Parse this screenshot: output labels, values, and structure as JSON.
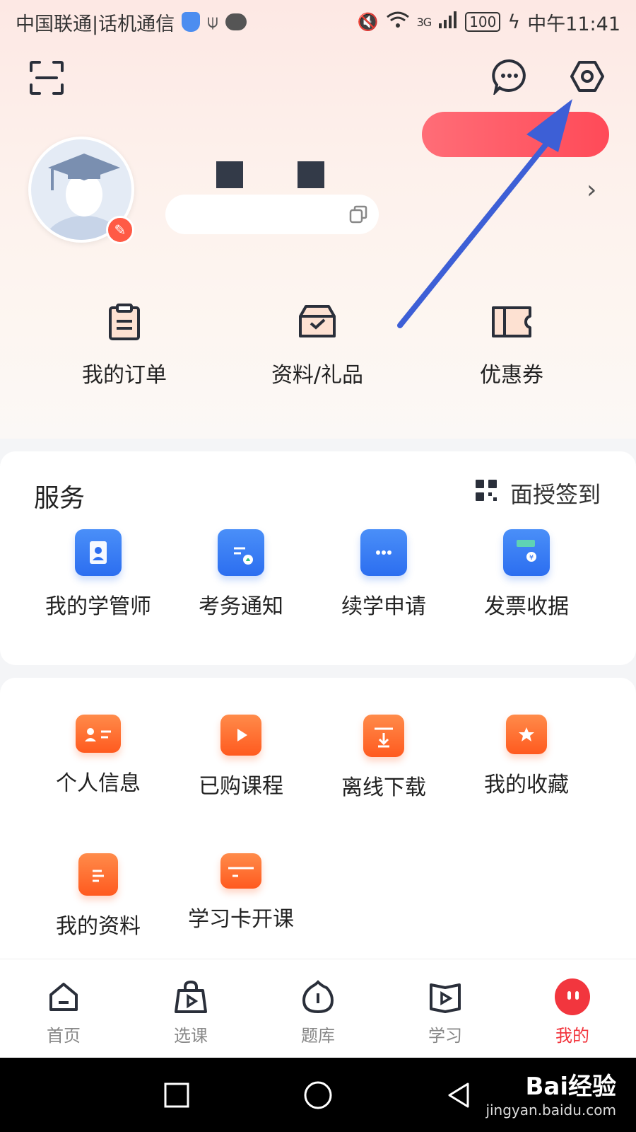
{
  "status_bar": {
    "carrier": "中国联通|话机通信",
    "battery": "100",
    "time": "中午11:41",
    "network": "3G"
  },
  "header": {
    "icons": [
      "scan-icon",
      "message-icon",
      "settings-icon"
    ]
  },
  "quick_links": [
    {
      "label": "我的订单",
      "icon": "clipboard-icon"
    },
    {
      "label": "资料/礼品",
      "icon": "inbox-check-icon"
    },
    {
      "label": "优惠券",
      "icon": "coupon-icon"
    }
  ],
  "services": {
    "title": "服务",
    "checkin_label": "面授签到",
    "items": [
      {
        "label": "我的学管师",
        "icon": "tutor-icon"
      },
      {
        "label": "考务通知",
        "icon": "exam-notice-icon"
      },
      {
        "label": "续学申请",
        "icon": "chat-icon"
      },
      {
        "label": "发票收据",
        "icon": "wallet-icon"
      }
    ]
  },
  "more": {
    "items": [
      {
        "label": "个人信息",
        "icon": "id-card-icon"
      },
      {
        "label": "已购课程",
        "icon": "play-icon"
      },
      {
        "label": "离线下载",
        "icon": "download-icon"
      },
      {
        "label": "我的收藏",
        "icon": "star-folder-icon"
      },
      {
        "label": "我的资料",
        "icon": "document-icon"
      },
      {
        "label": "学习卡开课",
        "icon": "card-icon"
      }
    ]
  },
  "bottom_nav": [
    {
      "label": "首页",
      "active": false
    },
    {
      "label": "选课",
      "active": false
    },
    {
      "label": "题库",
      "active": false
    },
    {
      "label": "学习",
      "active": false
    },
    {
      "label": "我的",
      "active": true
    }
  ],
  "colors": {
    "accent_red": "#f2363e",
    "service_blue": "#2c6ef0",
    "feature_orange": "#ff5a1f",
    "annotation_arrow": "#3d5fd6"
  },
  "watermark": {
    "brand": "Bai经验",
    "url": "jingyan.baidu.com"
  }
}
